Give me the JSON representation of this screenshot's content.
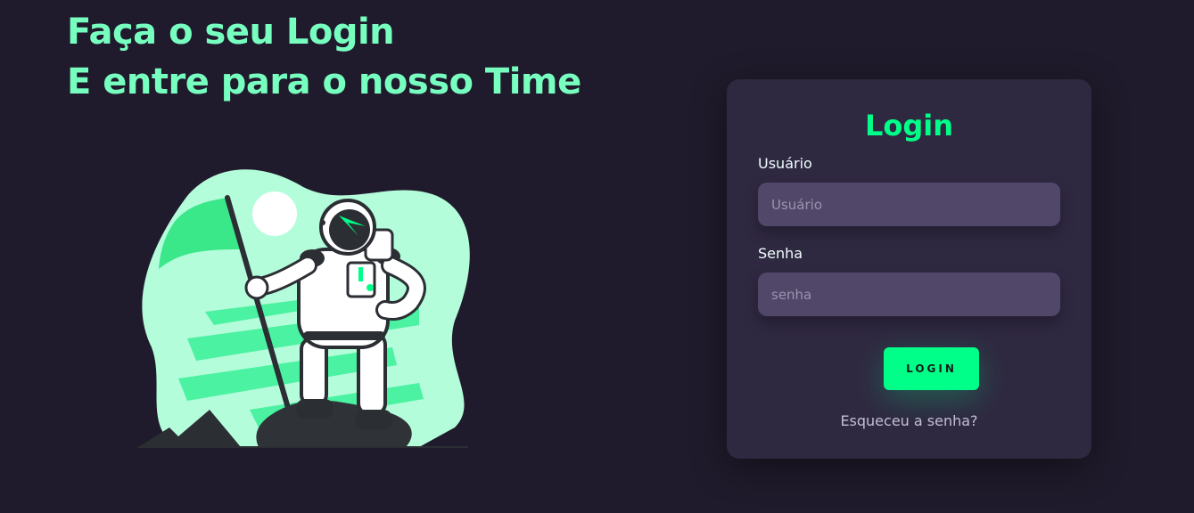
{
  "hero": {
    "line1": "Faça o seu Login",
    "line2": "E entre para o nosso Time",
    "illustration_icon": "astronaut-with-flag-illustration"
  },
  "login_card": {
    "title": "Login",
    "username": {
      "label": "Usuário",
      "placeholder": "Usuário",
      "value": ""
    },
    "password": {
      "label": "Senha",
      "placeholder": "senha",
      "value": ""
    },
    "submit_label": "LOGIN",
    "forgot_password": "Esqueceu a senha?"
  },
  "colors": {
    "background": "#201b2c",
    "card": "#2f2841",
    "input": "#514869",
    "accent": "#00ff88",
    "headline": "#77ffc0"
  }
}
